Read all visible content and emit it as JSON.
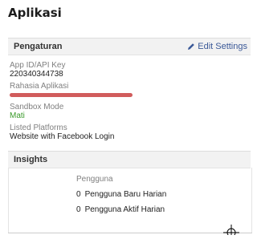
{
  "page": {
    "title": "Aplikasi"
  },
  "settings": {
    "title": "Pengaturan",
    "edit_label": "Edit Settings",
    "edit_icon": "pencil-icon",
    "app_id_label": "App ID/API Key",
    "app_id_value": "220340344738",
    "secret_label": "Rahasia Aplikasi",
    "sandbox_label": "Sandbox Mode",
    "sandbox_value": "Mati",
    "platforms_label": "Listed Platforms",
    "platforms_value": "Website with Facebook Login"
  },
  "insights": {
    "title": "Insights",
    "subhead": "Pengguna",
    "rows": [
      {
        "count": "0",
        "label": "Pengguna Baru Harian"
      },
      {
        "count": "0",
        "label": "Pengguna Aktif Harian"
      }
    ]
  },
  "colors": {
    "link": "#3b5998",
    "status_off": "#3a9a2a",
    "redaction": "#cc4a4a"
  },
  "cursor_icon": "crosshair-cursor-icon"
}
